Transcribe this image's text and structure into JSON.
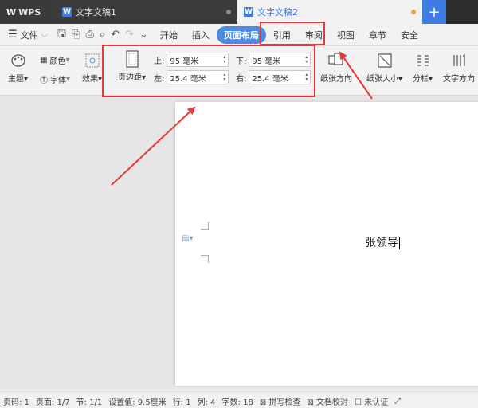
{
  "titlebar": {
    "app_name": "WPS",
    "tabs": [
      {
        "label": "文字文稿1"
      },
      {
        "label": "文字文稿2"
      }
    ],
    "add_label": "+"
  },
  "menubar": {
    "file_label": "文件",
    "items": [
      "开始",
      "插入",
      "页面布局",
      "引用",
      "审阅",
      "视图",
      "章节",
      "安全"
    ],
    "active": "页面布局"
  },
  "ribbon": {
    "theme_label": "主题",
    "color_label": "颜色",
    "font_label": "字体",
    "effect_label": "效果",
    "margins_label": "页边距",
    "margins": {
      "top_label": "上:",
      "top_value": "95 毫米",
      "bottom_label": "下:",
      "bottom_value": "95 毫米",
      "left_label": "左:",
      "left_value": "25.4 毫米",
      "right_label": "右:",
      "right_value": "25.4 毫米"
    },
    "orientation_label": "纸张方向",
    "size_label": "纸张大小",
    "columns_label": "分栏",
    "text_dir_label": "文字方向"
  },
  "document": {
    "text": "张领导"
  },
  "statusbar": {
    "items": [
      "页码: 1",
      "页面: 1/7",
      "节: 1/1",
      "设置值: 9.5厘米",
      "行: 1",
      "列: 4",
      "字数: 18",
      "拼写检查",
      "文档校对",
      "未认证"
    ]
  },
  "colors": {
    "titlebar_bg": "#2c2c2c",
    "accent": "#4a8be6",
    "annotation": "#e8383d"
  }
}
